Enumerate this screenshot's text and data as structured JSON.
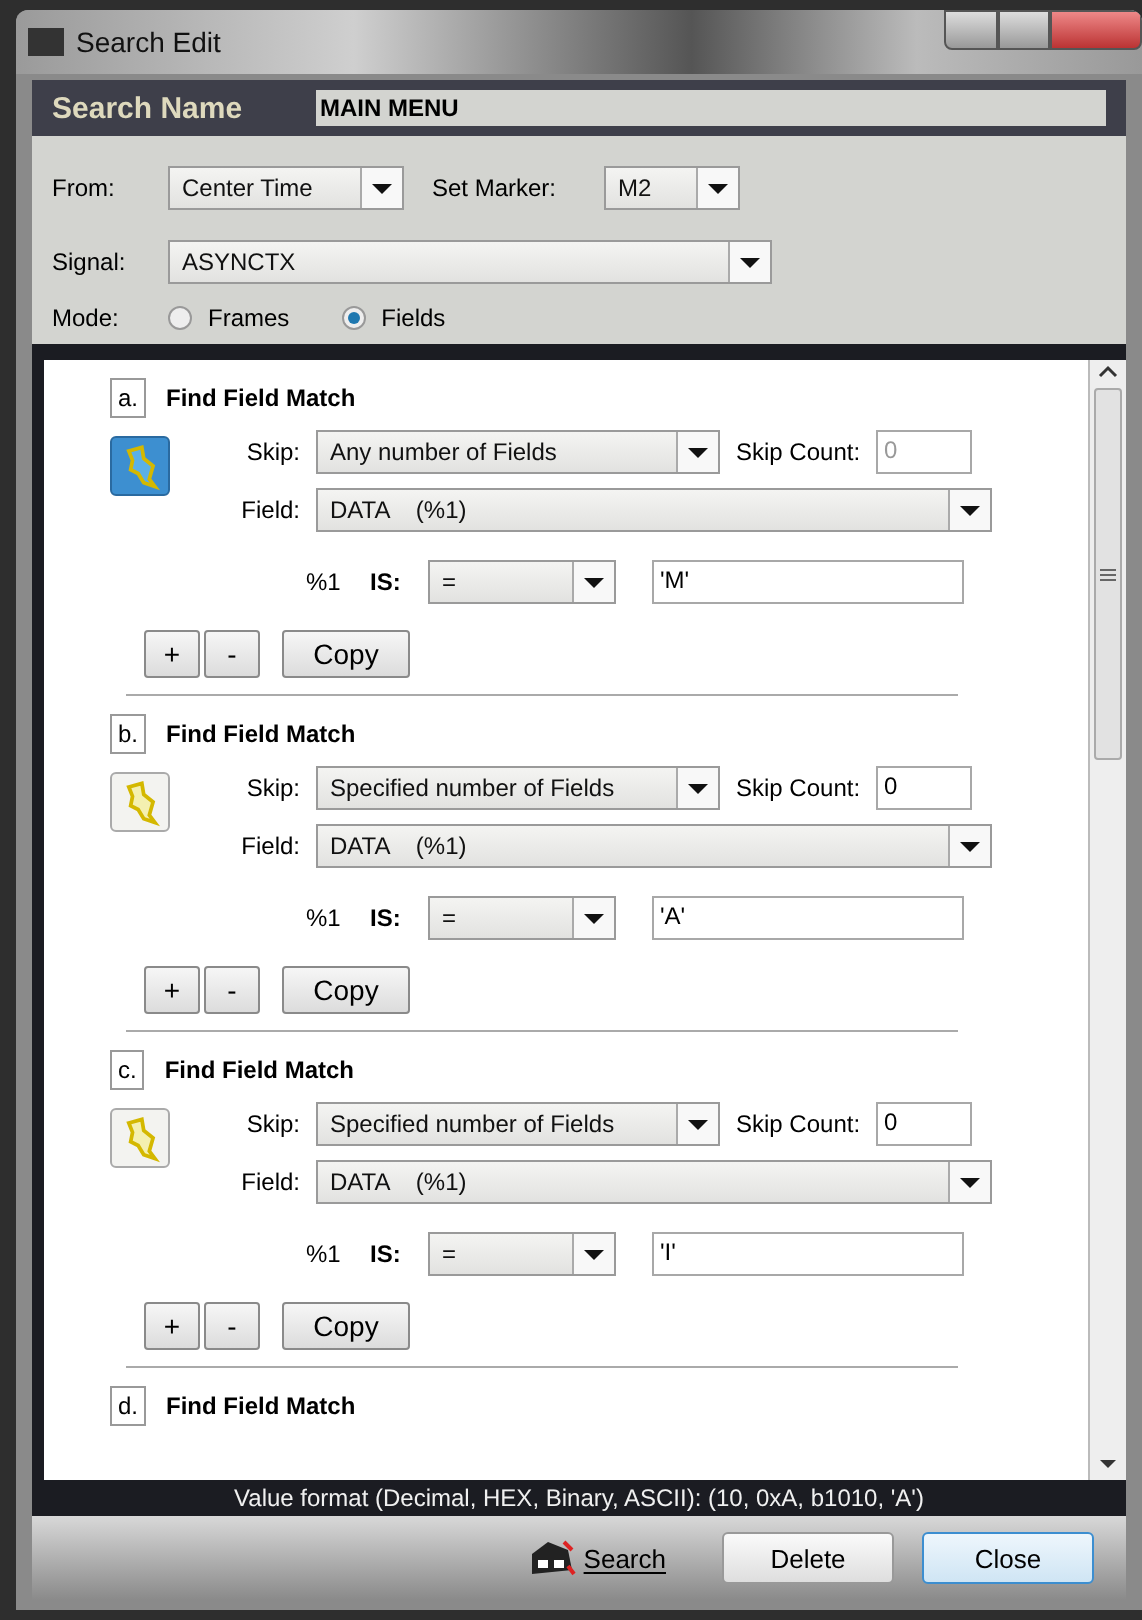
{
  "window": {
    "title": "Search Edit"
  },
  "search_name": {
    "label": "Search Name",
    "value": "MAIN MENU"
  },
  "from": {
    "label": "From:",
    "value": "Center Time"
  },
  "set_marker": {
    "label": "Set Marker:",
    "value": "M2"
  },
  "signal": {
    "label": "Signal:",
    "value": "ASYNCTX"
  },
  "mode": {
    "label": "Mode:",
    "options": [
      {
        "label": "Frames",
        "selected": false
      },
      {
        "label": "Fields",
        "selected": true
      }
    ]
  },
  "steps": [
    {
      "letter": "a.",
      "title": "Find Field Match",
      "active": true,
      "skip_label": "Skip:",
      "skip": "Any number of Fields",
      "skip_count_label": "Skip Count:",
      "skip_count": "0",
      "skip_count_disabled": true,
      "field_label": "Field:",
      "field": "DATA    (%1)",
      "var": "%1",
      "is_label": "IS:",
      "operator": "=",
      "value": "'M'",
      "add": "+",
      "remove": "-",
      "copy": "Copy"
    },
    {
      "letter": "b.",
      "title": "Find Field Match",
      "active": false,
      "skip_label": "Skip:",
      "skip": "Specified number of Fields",
      "skip_count_label": "Skip Count:",
      "skip_count": "0",
      "skip_count_disabled": false,
      "field_label": "Field:",
      "field": "DATA    (%1)",
      "var": "%1",
      "is_label": "IS:",
      "operator": "=",
      "value": "'A'",
      "add": "+",
      "remove": "-",
      "copy": "Copy"
    },
    {
      "letter": "c.",
      "title": "Find Field Match",
      "active": false,
      "skip_label": "Skip:",
      "skip": "Specified number of Fields",
      "skip_count_label": "Skip Count:",
      "skip_count": "0",
      "skip_count_disabled": false,
      "field_label": "Field:",
      "field": "DATA    (%1)",
      "var": "%1",
      "is_label": "IS:",
      "operator": "=",
      "value": "'I'",
      "add": "+",
      "remove": "-",
      "copy": "Copy"
    },
    {
      "letter": "d.",
      "title": "Find Field Match"
    }
  ],
  "status_bar": "Value format (Decimal, HEX, Binary, ASCII):  (10, 0xA, b1010, 'A')",
  "buttons": {
    "search": "Search",
    "delete": "Delete",
    "close": "Close"
  }
}
